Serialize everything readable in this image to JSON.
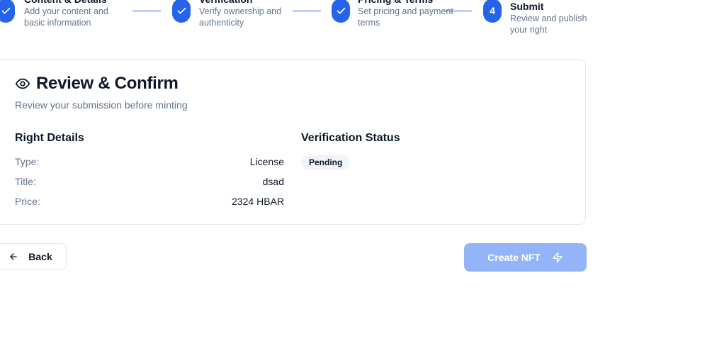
{
  "stepper": {
    "steps": [
      {
        "title": "Content & Details",
        "desc": "Add your content and basic information",
        "status": "complete"
      },
      {
        "title": "Verification",
        "desc": "Verify ownership and authenticity",
        "status": "complete"
      },
      {
        "title": "Pricing & Terms",
        "desc": "Set pricing and payment terms",
        "status": "complete"
      },
      {
        "number": "4",
        "title": "Submit",
        "desc": "Review and publish your right",
        "status": "current"
      }
    ],
    "accent": "#2563eb"
  },
  "review": {
    "title": "Review & Confirm",
    "subtitle": "Review your submission before minting",
    "details": {
      "heading": "Right Details",
      "rows": [
        {
          "label": "Type:",
          "value": "License"
        },
        {
          "label": "Title:",
          "value": "dsad"
        },
        {
          "label": "Price:",
          "value": "2324 HBAR"
        }
      ]
    },
    "verification": {
      "heading": "Verification Status",
      "status": "Pending"
    }
  },
  "actions": {
    "back_label": "Back",
    "create_label": "Create NFT",
    "create_color": "#93b4f8"
  }
}
